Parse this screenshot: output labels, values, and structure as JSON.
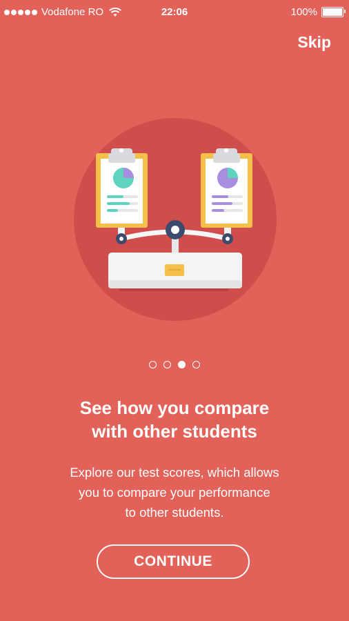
{
  "status_bar": {
    "carrier": "Vodafone RO",
    "time": "22:06",
    "battery": "100%",
    "battery_level": 1.0
  },
  "header": {
    "skip_label": "Skip"
  },
  "illustration": {
    "icon": "balance-scale-with-clipboards-icon"
  },
  "pagination": {
    "total": 4,
    "active_index": 2
  },
  "content": {
    "headline": "See how you compare\nwith other students",
    "description": "Explore our test scores, which allows\nyou to compare your performance\nto other students."
  },
  "actions": {
    "continue_label": "CONTINUE"
  },
  "colors": {
    "background": "#e2625a",
    "circle": "#cf4e4b",
    "scale_base": "#f5f5f5",
    "clipboard_frame": "#f5c04a",
    "pie_teal": "#5ed3bf",
    "pie_purple": "#a88ee0",
    "knob_navy": "#3c4a6b"
  }
}
